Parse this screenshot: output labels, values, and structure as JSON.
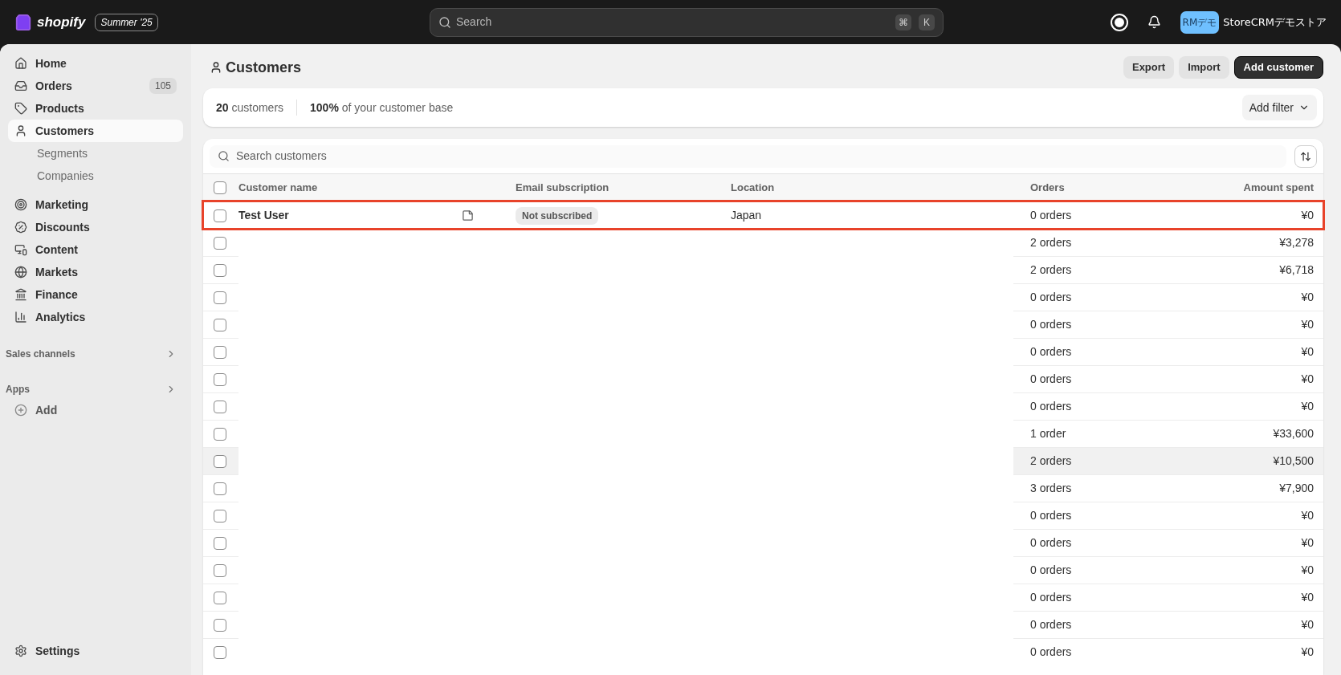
{
  "topbar": {
    "brand": "shopify",
    "edition": "Summer '25",
    "search": {
      "placeholder": "Search",
      "keys": [
        "⌘",
        "K"
      ]
    },
    "avatar": "RMデモ",
    "store": "StoreCRMデモストア"
  },
  "sidebar": {
    "items": [
      {
        "label": "Home",
        "selected": false
      },
      {
        "label": "Orders",
        "badge": "105",
        "selected": false
      },
      {
        "label": "Products",
        "selected": false
      },
      {
        "label": "Customers",
        "selected": true,
        "children": [
          {
            "label": "Segments"
          },
          {
            "label": "Companies"
          }
        ]
      },
      {
        "label": "Marketing",
        "selected": false
      },
      {
        "label": "Discounts",
        "selected": false
      },
      {
        "label": "Content",
        "selected": false
      },
      {
        "label": "Markets",
        "selected": false
      },
      {
        "label": "Finance",
        "selected": false
      },
      {
        "label": "Analytics",
        "selected": false
      }
    ],
    "sections": [
      {
        "label": "Sales channels"
      },
      {
        "label": "Apps",
        "items": [
          {
            "label": "Add"
          }
        ]
      }
    ],
    "footer": {
      "label": "Settings"
    }
  },
  "page": {
    "title": "Customers",
    "buttons": [
      {
        "label": "Export",
        "kind": "secondary"
      },
      {
        "label": "Import",
        "kind": "secondary"
      },
      {
        "label": "Add customer",
        "kind": "primary"
      }
    ]
  },
  "summary": {
    "count": "20",
    "count_label": "customers",
    "share": "100%",
    "share_label": "of your customer base",
    "filter": "Add filter"
  },
  "table": {
    "search": {
      "placeholder": "Search customers"
    },
    "select_all": {
      "checked": false
    },
    "columns": [
      "Customer name",
      "Email subscription",
      "Location",
      "Orders",
      "Amount spent"
    ],
    "rows": [
      {
        "name": "Test User",
        "note": true,
        "subscription": "Not subscribed",
        "location": "Japan",
        "orders": "0 orders",
        "amount": "¥0",
        "checked": false,
        "outlined": true,
        "hovered": false
      },
      {
        "orders": "2 orders",
        "amount": "¥3,278",
        "checked": false,
        "outlined": false,
        "hovered": false
      },
      {
        "orders": "2 orders",
        "amount": "¥6,718",
        "checked": false,
        "outlined": false,
        "hovered": false
      },
      {
        "orders": "0 orders",
        "amount": "¥0",
        "checked": false,
        "outlined": false,
        "hovered": false
      },
      {
        "orders": "0 orders",
        "amount": "¥0",
        "checked": false,
        "outlined": false,
        "hovered": false
      },
      {
        "orders": "0 orders",
        "amount": "¥0",
        "checked": false,
        "outlined": false,
        "hovered": false
      },
      {
        "orders": "0 orders",
        "amount": "¥0",
        "checked": false,
        "outlined": false,
        "hovered": false
      },
      {
        "orders": "0 orders",
        "amount": "¥0",
        "checked": false,
        "outlined": false,
        "hovered": false
      },
      {
        "orders": "1 order",
        "amount": "¥33,600",
        "checked": false,
        "outlined": false,
        "hovered": false
      },
      {
        "orders": "2 orders",
        "amount": "¥10,500",
        "checked": false,
        "outlined": false,
        "hovered": true
      },
      {
        "orders": "3 orders",
        "amount": "¥7,900",
        "checked": false,
        "outlined": false,
        "hovered": false
      },
      {
        "orders": "0 orders",
        "amount": "¥0",
        "checked": false,
        "outlined": false,
        "hovered": false
      },
      {
        "orders": "0 orders",
        "amount": "¥0",
        "checked": false,
        "outlined": false,
        "hovered": false
      },
      {
        "orders": "0 orders",
        "amount": "¥0",
        "checked": false,
        "outlined": false,
        "hovered": false
      },
      {
        "orders": "0 orders",
        "amount": "¥0",
        "checked": false,
        "outlined": false,
        "hovered": false
      },
      {
        "orders": "0 orders",
        "amount": "¥0",
        "checked": false,
        "outlined": false,
        "hovered": false
      },
      {
        "orders": "0 orders",
        "amount": "¥0",
        "checked": false,
        "outlined": false,
        "hovered": false
      }
    ]
  }
}
